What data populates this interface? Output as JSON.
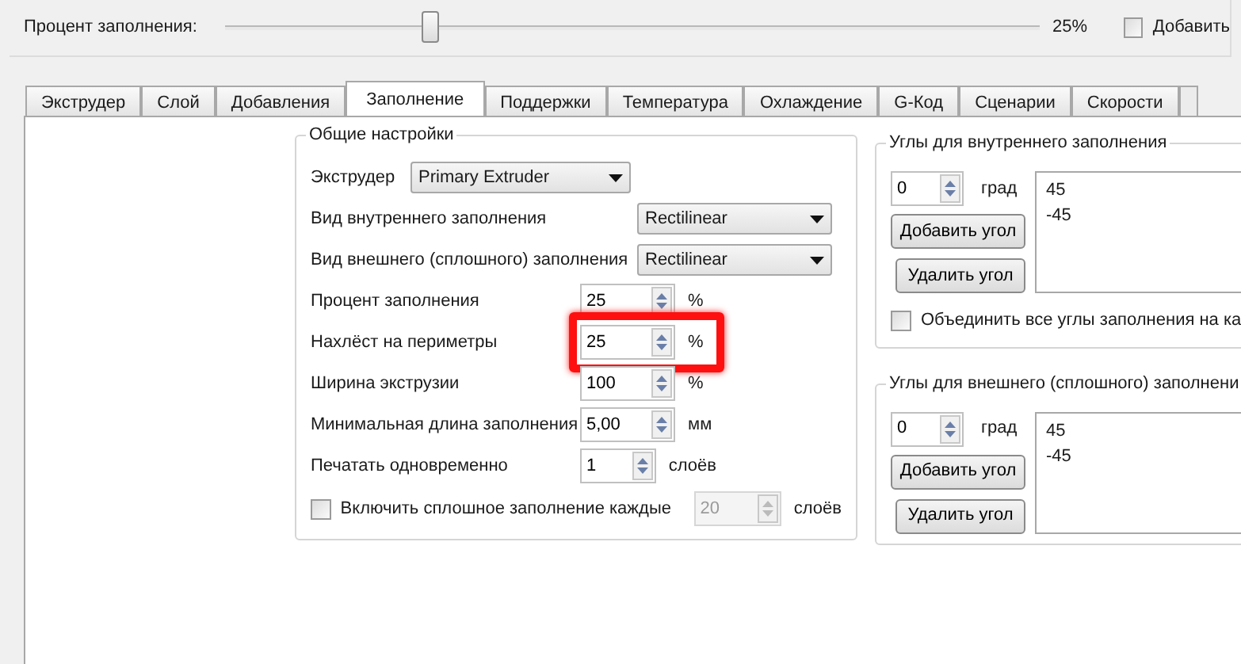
{
  "top": {
    "label": "Процент заполнения:",
    "slider": {
      "level": 0.25
    },
    "reading": "25%",
    "checkbox": {
      "label": "Добавить",
      "checked": false
    }
  },
  "tabs": [
    {
      "label": "Экструдер",
      "selected": false
    },
    {
      "label": "Слой",
      "selected": false
    },
    {
      "label": "Добавления",
      "selected": false
    },
    {
      "label": "Заполнение",
      "selected": true
    },
    {
      "label": "Поддержки",
      "selected": false
    },
    {
      "label": "Температура",
      "selected": false
    },
    {
      "label": "Охлаждение",
      "selected": false
    },
    {
      "label": "G-Код",
      "selected": false
    },
    {
      "label": "Сценарии",
      "selected": false
    },
    {
      "label": "Скорости",
      "selected": false
    }
  ],
  "general": {
    "title": "Общие настройки",
    "rows": [
      {
        "kind": "combo",
        "label": "Экструдер",
        "value": "Primary Extruder",
        "wide": false
      },
      {
        "kind": "combo",
        "label": "Вид внутреннего заполнения",
        "value": "Rectilinear",
        "wide": true
      },
      {
        "kind": "combo",
        "label": "Вид внешнего (сплошного) заполнения",
        "value": "Rectilinear",
        "wide": true
      },
      {
        "kind": "spin",
        "label": "Процент заполнения",
        "value": "25",
        "unit": "%",
        "highlighted": false
      },
      {
        "kind": "spin",
        "label": "Нахлёст на периметры",
        "value": "25",
        "unit": "%",
        "highlighted": true
      },
      {
        "kind": "spin",
        "label": "Ширина экструзии",
        "value": "100",
        "unit": "%",
        "highlighted": false
      },
      {
        "kind": "spin",
        "label": "Минимальная длина заполнения",
        "value": "5,00",
        "unit": "мм",
        "highlighted": false
      },
      {
        "kind": "spin",
        "label": "Печатать одновременно",
        "value": "1",
        "unit": "слоёв",
        "highlighted": false
      }
    ],
    "solid": {
      "label": "Включить сплошное заполнение каждые",
      "checked": false,
      "value": "20",
      "unit": "слоёв",
      "disabled": true
    }
  },
  "angle_groups": [
    {
      "title": "Углы для внутреннего заполнения",
      "value": "0",
      "unit": "град",
      "add": "Добавить угол",
      "remove": "Удалить угол",
      "angles": [
        "45",
        "-45"
      ],
      "merge": {
        "label": "Объединить все углы заполнения на ка",
        "checked": false
      }
    },
    {
      "title": "Углы для внешнего (сплошного) заполнени",
      "value": "0",
      "unit": "град",
      "add": "Добавить угол",
      "remove": "Удалить угол",
      "angles": [
        "45",
        "-45"
      ]
    }
  ]
}
